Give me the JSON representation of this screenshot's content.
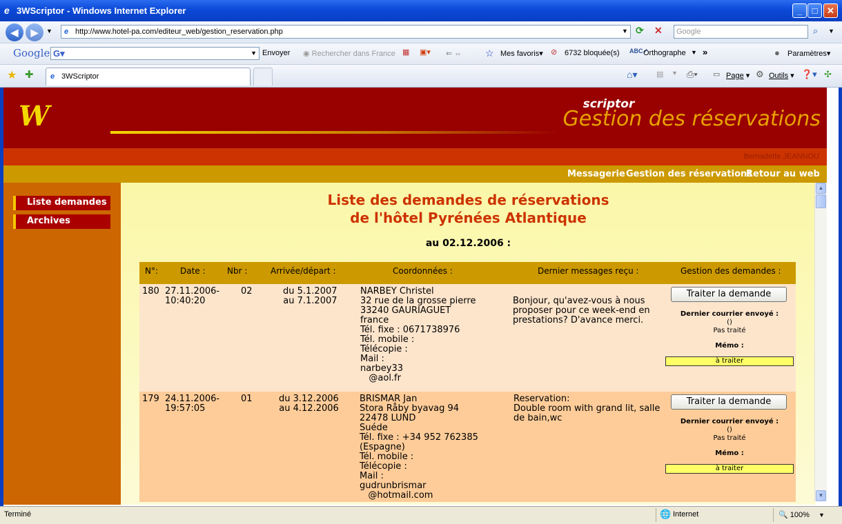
{
  "window": {
    "title": "3WScriptor - Windows Internet Explorer"
  },
  "toolbar": {
    "address": "http://www.hotel-pa.com/editeur_web/gestion_reservation.php",
    "search_placeholder": "Google"
  },
  "google_bar": {
    "logo": "Google",
    "send": "Envoyer",
    "search_france": "Rechercher dans France",
    "favorites": "Mes favoris",
    "blocked": "6732 bloquée(s)",
    "spelling": "Orthographe",
    "more": "»",
    "settings": "Paramètres"
  },
  "tabbar": {
    "tab_label": "3WScriptor",
    "page_menu": "Page",
    "tools_menu": "Outils"
  },
  "site": {
    "logo_main": "W",
    "logo_sub": "scriptor",
    "page_title": "Gestion des réservations",
    "user": "Bernadette JEANNOU",
    "nav": [
      "Messagerie",
      "Gestion des réservations",
      "Retour au web"
    ],
    "left_menu": [
      "Liste demandes",
      "Archives"
    ]
  },
  "content": {
    "heading_line1": "Liste des demandes de réservations",
    "heading_line2": "de l'hôtel Pyrénées Atlantique",
    "date_line": "au 02.12.2006 :",
    "columns": [
      "N°:",
      "Date :",
      "Nbr :",
      "Arrivée/départ :",
      "Coordonnées :",
      "Dernier messages reçu :",
      "Gestion des demandes :"
    ],
    "rows": [
      {
        "num": "180",
        "date1": "27.11.2006-",
        "date2": "10:40:20",
        "nbr": "02",
        "arr1": "du 5.1.2007",
        "arr2": "au 7.1.2007",
        "coords": [
          "NARBEY Christel",
          "32 rue de la grosse pierre",
          "33240 GAURIAGUET",
          "france",
          "Tél. fixe : 0671738976",
          "Tél. mobile :",
          "Télécopie :",
          "Mail :",
          "narbey33",
          "   @aol.fr"
        ],
        "message": [
          "Bonjour, qu'avez-vous à nous",
          "proposer pour ce week-end en",
          "prestations? D'avance merci."
        ],
        "button": "Traiter la demande",
        "last_mail_label": "Dernier courrier envoyé :",
        "last_mail_value": "()",
        "status": "Pas traité",
        "memo_label": "Mémo :",
        "memo_value": "à traiter"
      },
      {
        "num": "179",
        "date1": "24.11.2006-",
        "date2": "19:57:05",
        "nbr": "01",
        "arr1": "du 3.12.2006",
        "arr2": "au 4.12.2006",
        "coords": [
          "BRISMAR Jan",
          "Stora Råby byavag 94",
          "22478 LUND",
          "Suéde",
          "Tél. fixe : +34 952 762385",
          "(Espagne)",
          "Tél. mobile :",
          "Télécopie :",
          "Mail :",
          "gudrunbrismar",
          "   @hotmail.com"
        ],
        "message": [
          "Reservation:",
          "Double room with grand lit, salle",
          "de bain,wc"
        ],
        "button": "Traiter la demande",
        "last_mail_label": "Dernier courrier envoyé :",
        "last_mail_value": "()",
        "status": "Pas traité",
        "memo_label": "Mémo :",
        "memo_value": "à traiter"
      }
    ]
  },
  "status": {
    "left": "Terminé",
    "zone": "Internet",
    "zoom": "100%"
  },
  "colors": {
    "header": "#990000",
    "accent_gold": "#cc9900",
    "left_panel": "#cc6600",
    "row1_bg": "#fde5cc",
    "row2_bg": "#fdcc99"
  }
}
